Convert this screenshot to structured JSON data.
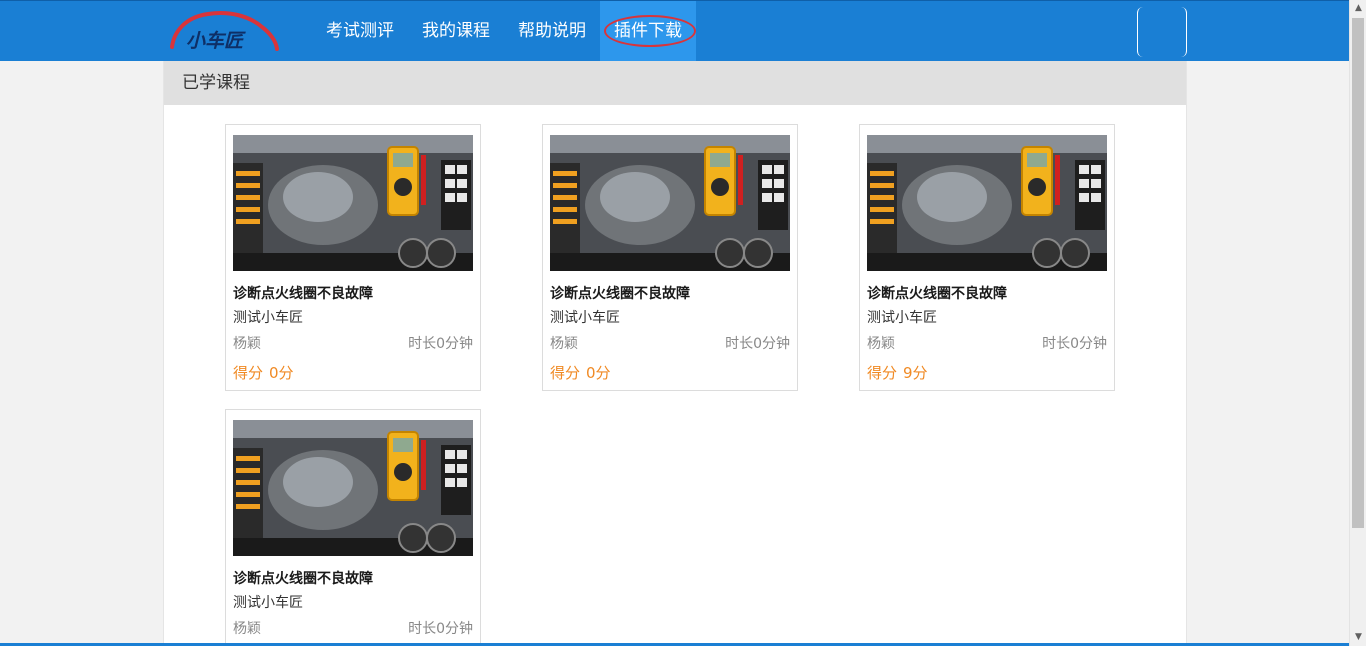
{
  "header": {
    "logo_text": "小车匠",
    "nav": [
      {
        "label": "考试测评"
      },
      {
        "label": "我的课程"
      },
      {
        "label": "帮助说明"
      },
      {
        "label": "插件下载"
      }
    ],
    "active_nav": "插件下载",
    "colors": {
      "bar": "#1a7fd4",
      "active": "#2d97ec",
      "highlight_ring": "#d9343a"
    }
  },
  "section": {
    "title": "已学课程"
  },
  "courses": [
    {
      "title": "诊断点火线圈不良故障",
      "subtitle": "测试小车匠",
      "author": "杨颖",
      "duration": "时长0分钟",
      "score_label": "得分",
      "score": "0分"
    },
    {
      "title": "诊断点火线圈不良故障",
      "subtitle": "测试小车匠",
      "author": "杨颖",
      "duration": "时长0分钟",
      "score_label": "得分",
      "score": "0分"
    },
    {
      "title": "诊断点火线圈不良故障",
      "subtitle": "测试小车匠",
      "author": "杨颖",
      "duration": "时长0分钟",
      "score_label": "得分",
      "score": "9分"
    },
    {
      "title": "诊断点火线圈不良故障",
      "subtitle": "测试小车匠",
      "author": "杨颖",
      "duration": "时长0分钟"
    }
  ],
  "icons": {
    "thumbnail": "engine-bay-multimeter-image",
    "scroll_up": "arrow-up-icon",
    "scroll_down": "arrow-down-icon"
  }
}
